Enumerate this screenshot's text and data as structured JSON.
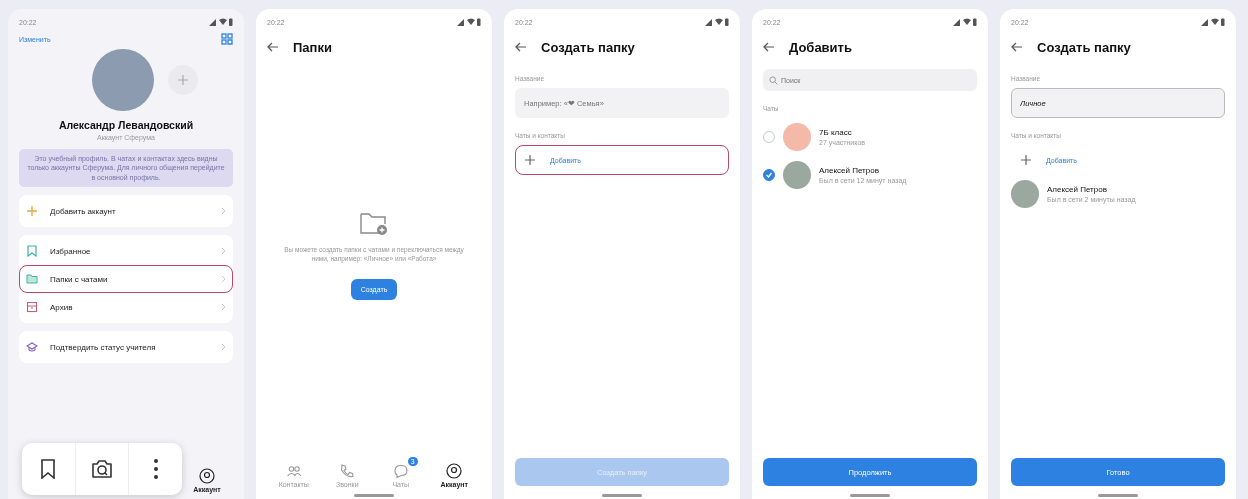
{
  "profile_screen": {
    "status_bar": {
      "time": "20:22"
    },
    "edit_link": "Изменить",
    "name": "Александр Левандовский",
    "subtitle": "Аккаунт Сферума",
    "notice": "Это учебный профиль. В чатах и контактах здесь видны только аккаунты Сферума. Для личного общения перейдите в основной профиль.",
    "menu_groups": [
      {
        "items": [
          {
            "kind": "add",
            "label": "Добавить аккаунт",
            "highlighted": false
          }
        ]
      },
      {
        "items": [
          {
            "kind": "bookmark",
            "label": "Избранное",
            "highlighted": false
          },
          {
            "kind": "folder",
            "label": "Папки с чатами",
            "highlighted": true
          },
          {
            "kind": "archive",
            "label": "Архив",
            "highlighted": false
          }
        ]
      },
      {
        "items": [
          {
            "kind": "teacher",
            "label": "Подтвердить статус учителя",
            "highlighted": false
          }
        ]
      }
    ],
    "tab": {
      "label": "Аккаунт",
      "selected": true
    }
  },
  "folders_screen": {
    "status_bar": {
      "time": "20:22"
    },
    "title": "Папки",
    "empty_text": "Вы можете создать папки с чатами и переключаться между ними, например: «Личное» или «Работа»",
    "create_button": "Создать",
    "tabs": [
      {
        "kind": "contacts",
        "label": "Контакты",
        "selected": false
      },
      {
        "kind": "calls",
        "label": "Звонки",
        "selected": false
      },
      {
        "kind": "chats",
        "label": "Чаты",
        "selected": false,
        "badge": "3"
      },
      {
        "kind": "account",
        "label": "Аккаунт",
        "selected": true
      }
    ]
  },
  "create_folder_screen": {
    "status_bar": {
      "time": "20:22"
    },
    "title": "Создать папку",
    "name_label": "Название",
    "name_field": {
      "placeholder": "Например: «❤ Семья»"
    },
    "section_label": "Чаты и контакты",
    "add_row": {
      "label": "Добавить",
      "highlighted": true
    },
    "submit_button": {
      "label": "Создать папку",
      "disabled": true
    }
  },
  "add_screen": {
    "status_bar": {
      "time": "20:22"
    },
    "title": "Добавить",
    "search": {
      "placeholder": "Поиск"
    },
    "section_label": "Чаты",
    "chats": [
      {
        "kind": "group",
        "name": "7Б класс",
        "detail": "27 участников",
        "selected": false
      },
      {
        "kind": "person",
        "name": "Алексей Петров",
        "detail": "Был в сети 12 минут назад",
        "selected": true
      }
    ],
    "submit_button": {
      "label": "Продолжить",
      "disabled": false
    }
  },
  "create_folder_filled_screen": {
    "status_bar": {
      "time": "20:22"
    },
    "title": "Создать папку",
    "name_label": "Название",
    "name_field": {
      "value": "Личное"
    },
    "section_label": "Чаты и контакты",
    "add_row": {
      "label": "Добавить",
      "highlighted": false
    },
    "members": [
      {
        "name": "Алексей Петров",
        "detail": "Был в сети 2 минуты назад"
      }
    ],
    "submit_button": {
      "label": "Готово",
      "disabled": false
    }
  }
}
